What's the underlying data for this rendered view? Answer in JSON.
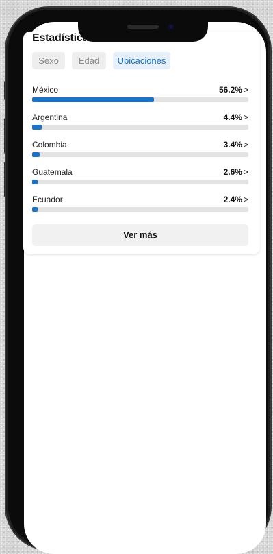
{
  "header": {
    "title": "Estadísticas…"
  },
  "tabs": [
    {
      "label": "Sexo",
      "active": false
    },
    {
      "label": "Edad",
      "active": false
    },
    {
      "label": "Ubicaciones",
      "active": true
    }
  ],
  "locations": [
    {
      "name": "México",
      "percent_text": "56.2%",
      "value": 56.2
    },
    {
      "name": "Argentina",
      "percent_text": "4.4%",
      "value": 4.4
    },
    {
      "name": "Colombia",
      "percent_text": "3.4%",
      "value": 3.4
    },
    {
      "name": "Guatemala",
      "percent_text": "2.6%",
      "value": 2.6
    },
    {
      "name": "Ecuador",
      "percent_text": "2.4%",
      "value": 2.4
    }
  ],
  "chevron": ">",
  "more_button": {
    "label": "Ver más"
  },
  "colors": {
    "accent": "#1a73c9",
    "track": "#e3e3e3",
    "tab_inactive_bg": "#eeeeee",
    "tab_active_bg": "#e6f0fb"
  },
  "icons": {
    "chevron": "chevron-right-icon",
    "camera": "front-camera-icon"
  }
}
